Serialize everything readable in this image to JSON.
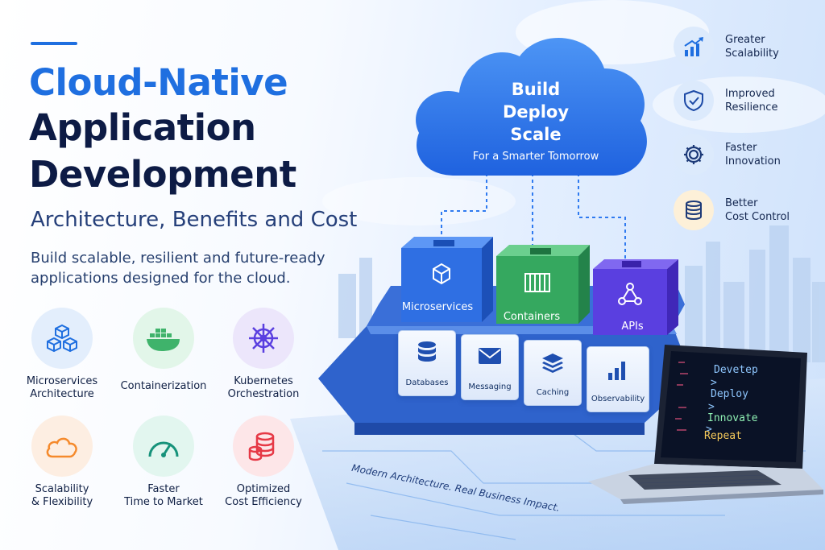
{
  "colors": {
    "accent_blue": "#1f6fe0",
    "navy": "#0d1b45",
    "cloud_blue": "#2f7af0",
    "green": "#3fb36b",
    "purple": "#5a3fe0",
    "red": "#e63946",
    "orange": "#f58a2c"
  },
  "header": {
    "title_line1": "Cloud-Native",
    "title_line2": "Application",
    "title_line3": "Development",
    "subtitle": "Architecture, Benefits and Cost",
    "description": "Build scalable, resilient and future-ready applications designed for the cloud."
  },
  "features": [
    {
      "icon": "cubes-icon",
      "line1": "Microservices",
      "line2": "Architecture"
    },
    {
      "icon": "docker-whale-icon",
      "line1": "Containerization",
      "line2": ""
    },
    {
      "icon": "helm-wheel-icon",
      "line1": "Kubernetes",
      "line2": "Orchestration"
    },
    {
      "icon": "cloud-icon",
      "line1": "Scalability",
      "line2": "& Flexibility"
    },
    {
      "icon": "speedometer-icon",
      "line1": "Faster",
      "line2": "Time to Market"
    },
    {
      "icon": "coin-stack-icon",
      "line1": "Optimized",
      "line2": "Cost Efficiency"
    }
  ],
  "cloud": {
    "line1": "Build",
    "line2": "Deploy",
    "line3": "Scale",
    "sub": "For a Smarter Tomorrow"
  },
  "cubes": [
    {
      "icon": "microservices-icon",
      "label": "Microservices"
    },
    {
      "icon": "container-icon",
      "label": "Containers"
    },
    {
      "icon": "api-graph-icon",
      "label": "APIs"
    }
  ],
  "services": [
    {
      "icon": "database-icon",
      "label": "Databases"
    },
    {
      "icon": "envelope-icon",
      "label": "Messaging"
    },
    {
      "icon": "layers-icon",
      "label": "Caching"
    },
    {
      "icon": "bar-chart-icon",
      "label": "Observability"
    }
  ],
  "benefits": [
    {
      "icon": "growth-chart-icon",
      "line1": "Greater",
      "line2": "Scalability"
    },
    {
      "icon": "shield-check-icon",
      "line1": "Improved",
      "line2": "Resilience"
    },
    {
      "icon": "gear-icon",
      "line1": "Faster",
      "line2": "Innovation"
    },
    {
      "icon": "coins-icon",
      "line1": "Better",
      "line2": "Cost Control"
    }
  ],
  "laptop": {
    "code": [
      "Devetep",
      ">",
      "Deploy",
      ">",
      "Innovate",
      ">",
      "Repeat"
    ]
  },
  "tagline": "Modern Architecture. Real Business Impact."
}
